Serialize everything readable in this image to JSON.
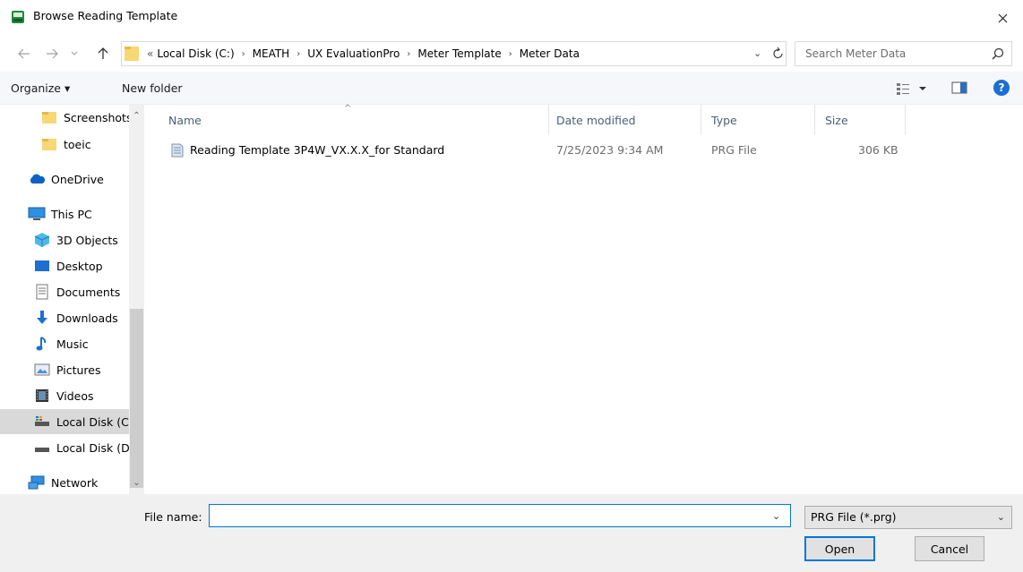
{
  "window": {
    "title": "Browse Reading Template"
  },
  "address": {
    "crumbs": [
      "«",
      "Local Disk (C:)",
      "MEATH",
      "UX EvaluationPro",
      "Meter Template",
      "Meter Data"
    ],
    "search_placeholder": "Search Meter Data"
  },
  "toolbar": {
    "organize": "Organize ▾",
    "new_folder": "New folder"
  },
  "sidebar": {
    "items": [
      {
        "label": "Screenshots",
        "icon": "folder-icon"
      },
      {
        "label": "toeic",
        "icon": "folder-icon"
      },
      {
        "label": "OneDrive",
        "icon": "cloud-icon"
      },
      {
        "label": "This PC",
        "icon": "computer-icon"
      },
      {
        "label": "3D Objects",
        "icon": "cube-icon"
      },
      {
        "label": "Desktop",
        "icon": "desktop-icon"
      },
      {
        "label": "Documents",
        "icon": "document-icon"
      },
      {
        "label": "Downloads",
        "icon": "download-icon"
      },
      {
        "label": "Music",
        "icon": "music-icon"
      },
      {
        "label": "Pictures",
        "icon": "pictures-icon"
      },
      {
        "label": "Videos",
        "icon": "video-icon"
      },
      {
        "label": "Local Disk (C:)",
        "icon": "drive-icon",
        "selected": true
      },
      {
        "label": "Local Disk (D:)",
        "icon": "drive-icon"
      },
      {
        "label": "Network",
        "icon": "network-icon"
      }
    ]
  },
  "columns": {
    "name": "Name",
    "date": "Date modified",
    "type": "Type",
    "size": "Size"
  },
  "files": [
    {
      "name": "Reading Template 3P4W_VX.X.X_for Standard",
      "date": "7/25/2023 9:34 AM",
      "type": "PRG File",
      "size": "306 KB"
    }
  ],
  "bottom": {
    "file_name_label": "File name:",
    "file_name_value": "",
    "file_type": "PRG File (*.prg)",
    "open": "Open",
    "cancel": "Cancel"
  },
  "colors": {
    "accent": "#0078d7",
    "folder": "#f8d775",
    "selected": "#d9d9d9"
  }
}
